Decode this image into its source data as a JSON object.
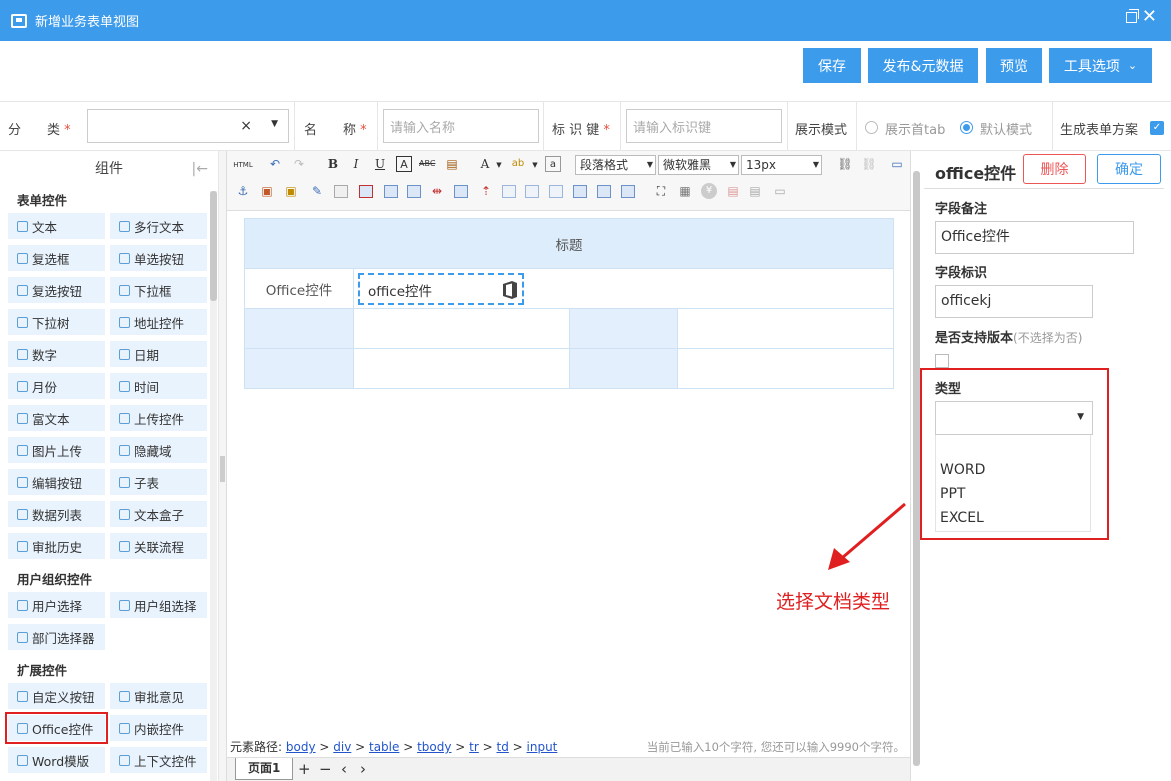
{
  "window": {
    "title": "新增业务表单视图"
  },
  "toolbar": {
    "save": "保存",
    "publish": "发布&元数据",
    "preview": "预览",
    "tools": "工具选项"
  },
  "meta": {
    "category_label": "分　　类",
    "name_label": "名　　称",
    "name_placeholder": "请输入名称",
    "key_label": "标 识 键",
    "key_placeholder": "请输入标识键",
    "display_mode_label": "展示模式",
    "option_first_tab": "展示首tab",
    "option_default": "默认模式",
    "generate_label": "生成表单方案",
    "required_mark": "*",
    "clear_mark": "×"
  },
  "left_panel": {
    "title": "组件",
    "groups": [
      {
        "title": "表单控件",
        "items": [
          "文本",
          "多行文本",
          "复选框",
          "单选按钮",
          "复选按钮",
          "下拉框",
          "下拉树",
          "地址控件",
          "数字",
          "日期",
          "月份",
          "时间",
          "富文本",
          "上传控件",
          "图片上传",
          "隐藏域",
          "编辑按钮",
          "子表",
          "数据列表",
          "文本盒子",
          "审批历史",
          "关联流程"
        ]
      },
      {
        "title": "用户组织控件",
        "items": [
          "用户选择",
          "用户组选择",
          "部门选择器"
        ]
      },
      {
        "title": "扩展控件",
        "items": [
          "自定义按钮",
          "审批意见",
          "Office控件",
          "内嵌控件",
          "Word模版",
          "上下文控件"
        ]
      }
    ]
  },
  "editor_toolbar": {
    "html": "HTML",
    "paragraph_format": "段落格式",
    "font_family": "微软雅黑",
    "font_size": "13px"
  },
  "form_table": {
    "header": "标题",
    "field_label": "Office控件",
    "field_value": "office控件"
  },
  "path_bar": {
    "prefix": "元素路径:",
    "path": [
      "body",
      "div",
      "table",
      "tbody",
      "tr",
      "td",
      "input"
    ],
    "counter": "当前已输入10个字符, 您还可以输入9990个字符。"
  },
  "page_bar": {
    "tab": "页面1",
    "add": "+",
    "remove": "−",
    "prev": "‹",
    "next": "›"
  },
  "properties": {
    "title": "office控件",
    "delete": "删除",
    "confirm": "确定",
    "remark_label": "字段备注",
    "remark_value": "Office控件",
    "key_label": "字段标识",
    "key_value": "officekj",
    "version_label": "是否支持版本",
    "version_hint": "(不选择为否)",
    "type_label": "类型",
    "type_options": [
      "WORD",
      "PPT",
      "EXCEL"
    ]
  },
  "annotation": {
    "text": "选择文档类型"
  },
  "colors": {
    "primary": "#3d9bec",
    "highlight": "#e02020",
    "cell_blue": "#e3effc"
  }
}
